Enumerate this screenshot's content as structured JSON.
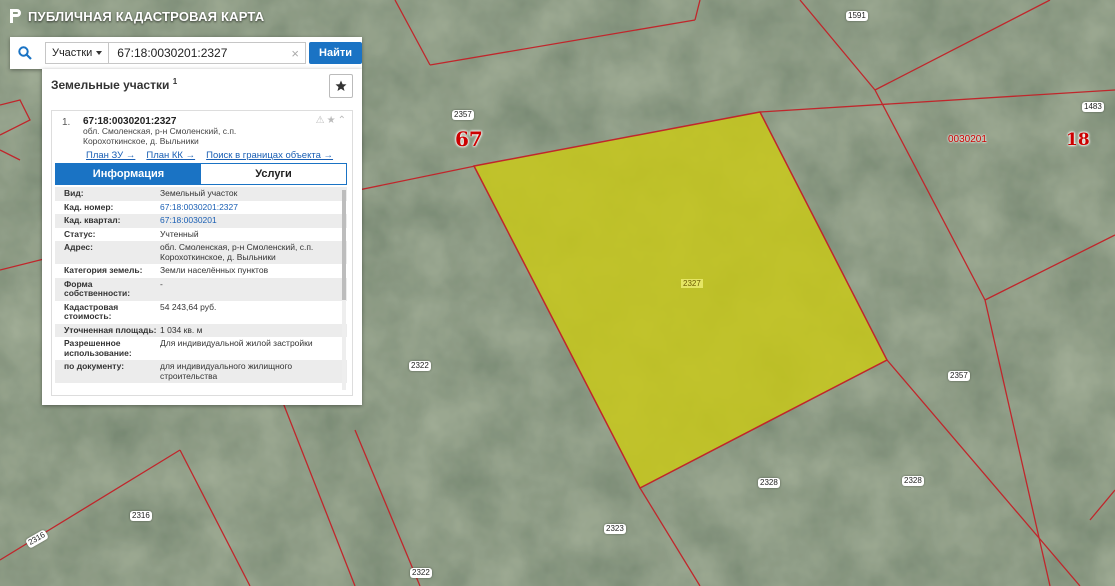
{
  "app": {
    "title": "ПУБЛИЧНАЯ КАДАСТРОВАЯ КАРТА"
  },
  "search": {
    "type_label": "Участки",
    "query": "67:18:0030201:2327",
    "find_label": "Найти"
  },
  "panel": {
    "title": "Земельные участки",
    "title_sup": "1",
    "result": {
      "num": "1.",
      "cad": "67:18:0030201:2327",
      "address": "обл. Смоленская, р-н Смоленский, с.п. Корохоткинское, д. Выльники",
      "links": [
        "План ЗУ →",
        "План КК →",
        "Поиск в границах объекта →"
      ]
    },
    "tabs": {
      "info": "Информация",
      "services": "Услуги"
    },
    "rows": [
      {
        "k": "Вид:",
        "v": "Земельный участок"
      },
      {
        "k": "Кад. номер:",
        "v": "67:18:0030201:2327"
      },
      {
        "k": "Кад. квартал:",
        "v": "67:18:0030201"
      },
      {
        "k": "Статус:",
        "v": "Учтенный"
      },
      {
        "k": "Адрес:",
        "v": "обл. Смоленская, р-н Смоленский, с.п. Корохоткинское, д. Выльники"
      },
      {
        "k": "Категория земель:",
        "v": "Земли населённых пунктов"
      },
      {
        "k": "Форма собственности:",
        "v": "-"
      },
      {
        "k": "Кадастровая стоимость:",
        "v": "54 243,64 руб."
      },
      {
        "k": "Уточненная площадь:",
        "v": "1 034 кв. м"
      },
      {
        "k": "Разрешенное использование:",
        "v": "Для индивидуальной жилой застройки"
      },
      {
        "k": "по документу:",
        "v": "для индивидуального жилищного строительства"
      }
    ]
  },
  "map": {
    "labels": [
      "1591",
      "2357",
      "1483",
      "0030201",
      "2327",
      "2322",
      "2357",
      "2328",
      "2328",
      "2316",
      "2316",
      "2323",
      "2322"
    ],
    "big": [
      "67",
      "18"
    ]
  },
  "colors": {
    "accent": "#1a73c4",
    "parcel": "#c8c81a",
    "boundary": "#c0262b"
  }
}
